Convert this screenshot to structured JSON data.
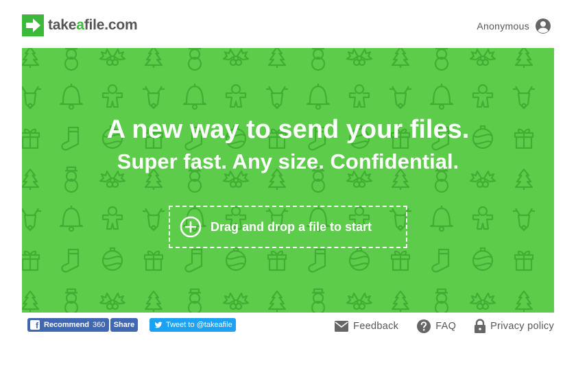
{
  "brand": {
    "name_pre": "take",
    "name_accent": "a",
    "name_post": "file.com",
    "color_green": "#3cb93c",
    "hero_color": "#5dcc4a"
  },
  "user": {
    "name": "Anonymous",
    "icon": "account-circle-icon"
  },
  "hero": {
    "title": "A new way to send your files.",
    "subtitle": "Super fast. Any size. Confidential.",
    "dropzone_label": "Drag and drop a file to start",
    "dropzone_icon": "plus-circle-icon",
    "pattern_icons": [
      "christmas-tree-icon",
      "snowman-icon",
      "holly-icon",
      "bell-icon",
      "gingerbread-icon",
      "reindeer-icon",
      "gift-icon",
      "stocking-icon",
      "ornament-icon"
    ]
  },
  "social": {
    "fb_label": "Recommend",
    "fb_count": "360",
    "share_label": "Share",
    "tweet_label": "Tweet to @takeafile"
  },
  "footer_links": {
    "feedback": "Feedback",
    "faq": "FAQ",
    "privacy": "Privacy policy"
  }
}
